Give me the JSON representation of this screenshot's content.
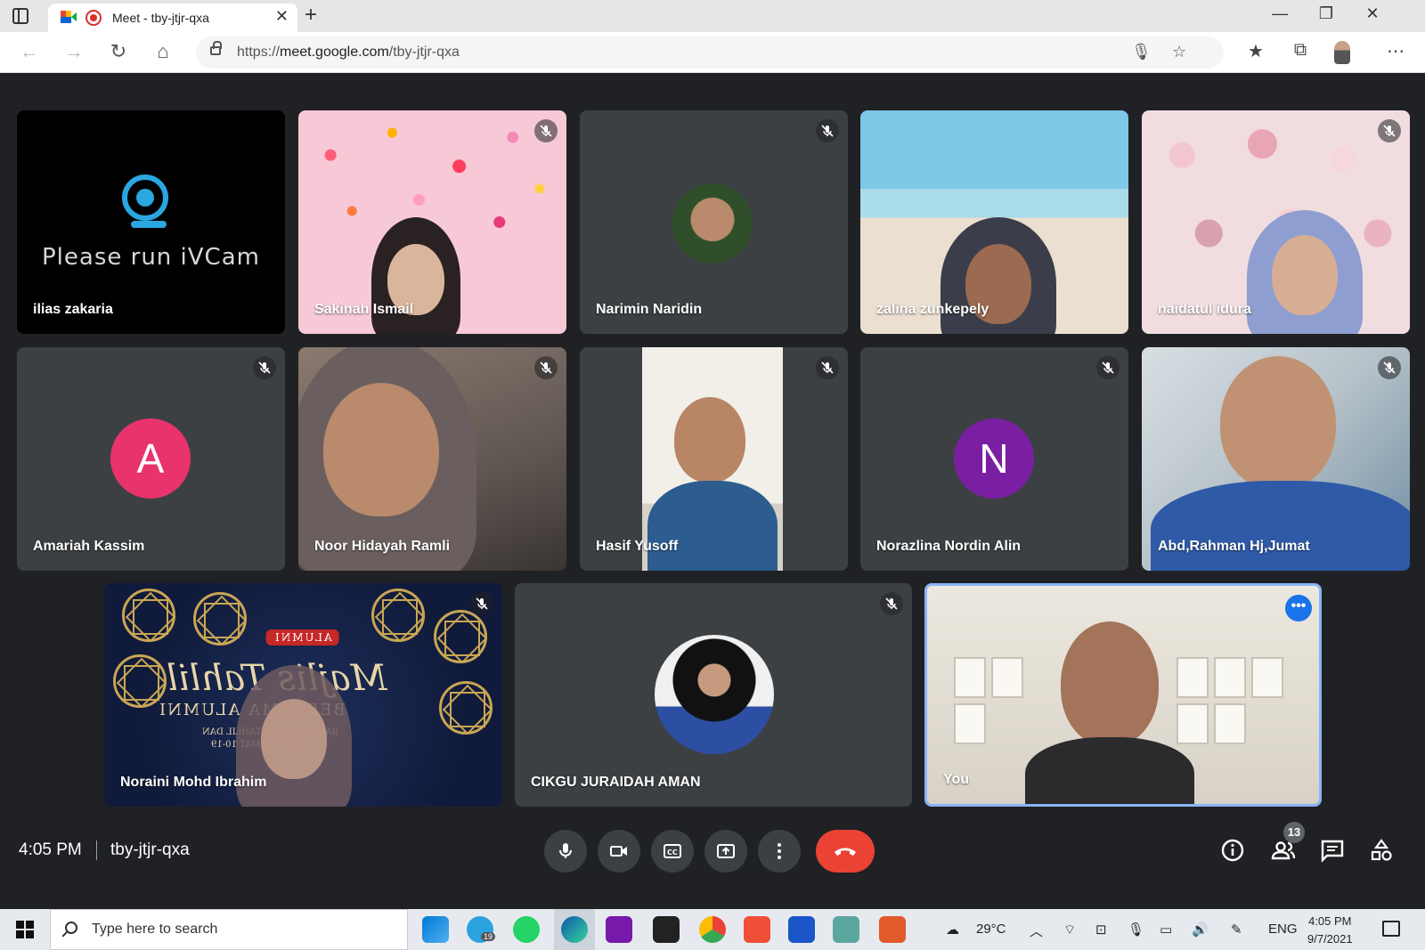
{
  "browser": {
    "tab_title": "Meet - tby-jtjr-qxa",
    "tab_close": "✕",
    "new_tab": "+",
    "url_prefix": "https://",
    "url_host": "meet.google.com",
    "url_path": "/tby-jtjr-qxa",
    "window_controls": [
      "—",
      "❐",
      "✕"
    ],
    "nav_icons": [
      "back-icon",
      "forward-icon",
      "refresh-icon",
      "home-icon"
    ],
    "toolbar_icons": [
      "favorites-icon",
      "collections-icon",
      "profile-icon",
      "more-icon"
    ]
  },
  "iv_message": "Please run iVCam",
  "participants": [
    {
      "name": "ilias zakaria",
      "muted": false
    },
    {
      "name": "Sakinah Ismail",
      "muted": true
    },
    {
      "name": "Narimin Naridin",
      "muted": true
    },
    {
      "name": "zalina zunkepely",
      "muted": false
    },
    {
      "name": "naidatul idura",
      "muted": true
    },
    {
      "name": "Amariah Kassim",
      "muted": true,
      "avatar_letter": "A",
      "avatar_color": "#e8336d"
    },
    {
      "name": "Noor Hidayah Ramli",
      "muted": true
    },
    {
      "name": "Hasif Yusoff",
      "muted": true
    },
    {
      "name": "Norazlina Nordin Alin",
      "muted": true,
      "avatar_letter": "N",
      "avatar_color": "#7b1fa2"
    },
    {
      "name": "Abd,Rahman Hj,Jumat",
      "muted": true
    },
    {
      "name": "Noraini Mohd Ibrahim",
      "muted": true
    },
    {
      "name": "CIKGU JURAIDAH AMAN",
      "muted": true
    },
    {
      "name": "You",
      "muted": false,
      "pinned_highlight": true
    }
  ],
  "banner": {
    "badge": "ALUMNI",
    "title": "Majlis Tahlil",
    "subtitle": "BERSAMA ALUMNI",
    "line1": "BACAAN YASIN, TAHLIL DAN",
    "line2": "DOA SELAMAT 10-19"
  },
  "more_options": "•••",
  "bottom_bar": {
    "time": "4:05 PM",
    "meeting_code": "tby-jtjr-qxa",
    "controls": [
      "mic-icon",
      "camera-icon",
      "captions-icon",
      "present-icon",
      "more-options-icon",
      "end-call-icon"
    ],
    "right_icons": [
      "info-icon",
      "people-icon",
      "chat-icon",
      "activities-icon"
    ],
    "people_count": "13",
    "end_call_color": "#ea4335"
  },
  "taskbar": {
    "search_placeholder": "Type here to search",
    "weather": "29°C",
    "language": "ENG",
    "clock_time": "4:05 PM",
    "clock_date": "9/7/2021",
    "telegram_badge": "19"
  }
}
